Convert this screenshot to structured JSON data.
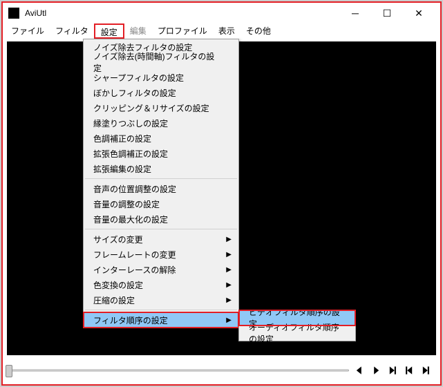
{
  "window": {
    "title": "AviUtl"
  },
  "menubar": {
    "items": [
      {
        "label": "ファイル",
        "disabled": false,
        "active": false
      },
      {
        "label": "フィルタ",
        "disabled": false,
        "active": false
      },
      {
        "label": "設定",
        "disabled": false,
        "active": true
      },
      {
        "label": "編集",
        "disabled": true,
        "active": false
      },
      {
        "label": "プロファイル",
        "disabled": false,
        "active": false
      },
      {
        "label": "表示",
        "disabled": false,
        "active": false
      },
      {
        "label": "その他",
        "disabled": false,
        "active": false
      }
    ]
  },
  "dropdown": {
    "groups": [
      [
        {
          "label": "ノイズ除去フィルタの設定",
          "has_submenu": false
        },
        {
          "label": "ノイズ除去(時間軸)フィルタの設定",
          "has_submenu": false
        },
        {
          "label": "シャープフィルタの設定",
          "has_submenu": false
        },
        {
          "label": "ぼかしフィルタの設定",
          "has_submenu": false
        },
        {
          "label": "クリッピング＆リサイズの設定",
          "has_submenu": false
        },
        {
          "label": "縁塗りつぶしの設定",
          "has_submenu": false
        },
        {
          "label": "色調補正の設定",
          "has_submenu": false
        },
        {
          "label": "拡張色調補正の設定",
          "has_submenu": false
        },
        {
          "label": "拡張編集の設定",
          "has_submenu": false
        }
      ],
      [
        {
          "label": "音声の位置調整の設定",
          "has_submenu": false
        },
        {
          "label": "音量の調整の設定",
          "has_submenu": false
        },
        {
          "label": "音量の最大化の設定",
          "has_submenu": false
        }
      ],
      [
        {
          "label": "サイズの変更",
          "has_submenu": true
        },
        {
          "label": "フレームレートの変更",
          "has_submenu": true
        },
        {
          "label": "インターレースの解除",
          "has_submenu": true
        },
        {
          "label": "色変換の設定",
          "has_submenu": true
        },
        {
          "label": "圧縮の設定",
          "has_submenu": true
        }
      ],
      [
        {
          "label": "フィルタ順序の設定",
          "has_submenu": true,
          "highlight": true,
          "boxed": true
        }
      ]
    ]
  },
  "submenu": {
    "items": [
      {
        "label": "ビデオフィルタ順序の設定",
        "highlight": true,
        "boxed": true
      },
      {
        "label": "オーディオフィルタ順序の設定",
        "highlight": false,
        "boxed": false
      }
    ]
  },
  "icons": {
    "minimize": "─",
    "maximize": "☐",
    "close": "✕",
    "arrow": "▶"
  }
}
